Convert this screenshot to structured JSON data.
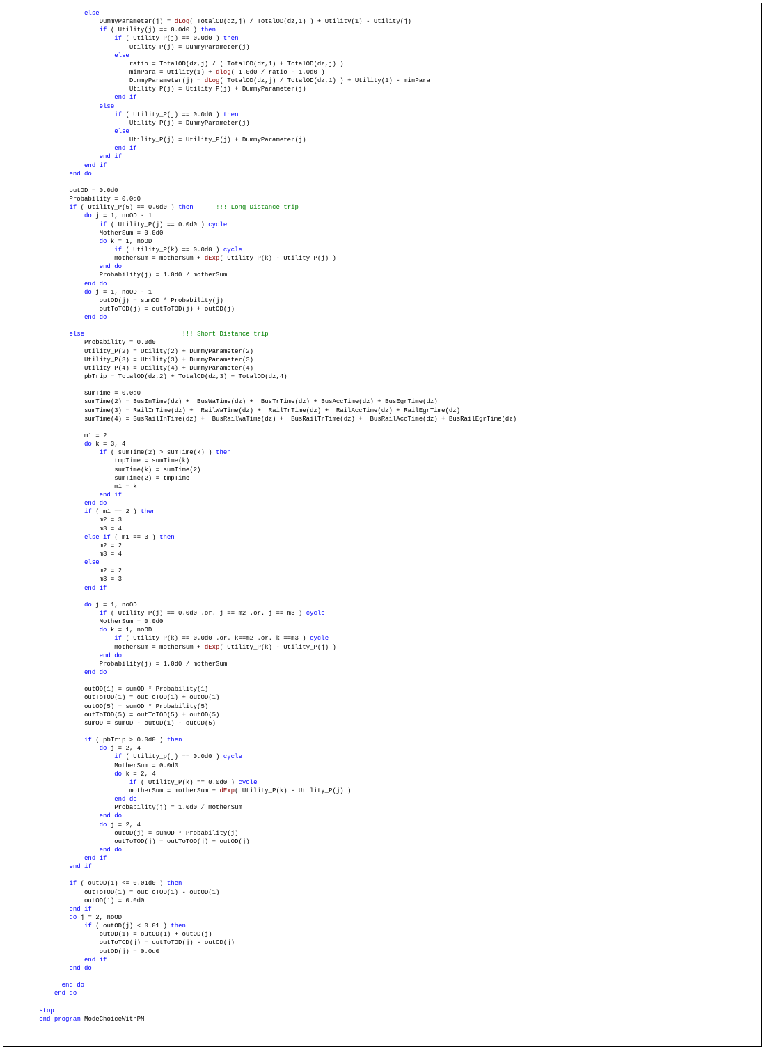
{
  "code": [
    {
      "indent": 12,
      "tokens": [
        {
          "t": "else",
          "c": "kw"
        }
      ]
    },
    {
      "indent": 16,
      "tokens": [
        {
          "t": "DummyParameter(j) = "
        },
        {
          "t": "dLog",
          "c": "fn"
        },
        {
          "t": "( TotalOD(dz,j) / TotalOD(dz,1) ) + Utility(1) - Utility(j)"
        }
      ]
    },
    {
      "indent": 16,
      "tokens": [
        {
          "t": "if",
          "c": "kw"
        },
        {
          "t": " ( Utility(j) == 0.0d0 ) "
        },
        {
          "t": "then",
          "c": "kw"
        }
      ]
    },
    {
      "indent": 20,
      "tokens": [
        {
          "t": "if",
          "c": "kw"
        },
        {
          "t": " ( Utility_P(j) == 0.0d0 ) "
        },
        {
          "t": "then",
          "c": "kw"
        }
      ]
    },
    {
      "indent": 24,
      "tokens": [
        {
          "t": "Utility_P(j) = DummyParameter(j)"
        }
      ]
    },
    {
      "indent": 20,
      "tokens": [
        {
          "t": "else",
          "c": "kw"
        }
      ]
    },
    {
      "indent": 24,
      "tokens": [
        {
          "t": "ratio = TotalOD(dz,j) / ( TotalOD(dz,1) + TotalOD(dz,j) )"
        }
      ]
    },
    {
      "indent": 24,
      "tokens": [
        {
          "t": "minPara = Utility(1) + "
        },
        {
          "t": "dlog",
          "c": "fn"
        },
        {
          "t": "( 1.0d0 / ratio - 1.0d0 )"
        }
      ]
    },
    {
      "indent": 24,
      "tokens": [
        {
          "t": "DummyParameter(j) = "
        },
        {
          "t": "dLog",
          "c": "fn"
        },
        {
          "t": "( TotalOD(dz,j) / TotalOD(dz,1) ) + Utility(1) - minPara"
        }
      ]
    },
    {
      "indent": 24,
      "tokens": [
        {
          "t": "Utility_P(j) = Utility_P(j) + DummyParameter(j)"
        }
      ]
    },
    {
      "indent": 20,
      "tokens": [
        {
          "t": "end if",
          "c": "kw"
        }
      ]
    },
    {
      "indent": 16,
      "tokens": [
        {
          "t": "else",
          "c": "kw"
        }
      ]
    },
    {
      "indent": 20,
      "tokens": [
        {
          "t": "if",
          "c": "kw"
        },
        {
          "t": " ( Utility_P(j) == 0.0d0 ) "
        },
        {
          "t": "then",
          "c": "kw"
        }
      ]
    },
    {
      "indent": 24,
      "tokens": [
        {
          "t": "Utility_P(j) = DummyParameter(j)"
        }
      ]
    },
    {
      "indent": 20,
      "tokens": [
        {
          "t": "else",
          "c": "kw"
        }
      ]
    },
    {
      "indent": 24,
      "tokens": [
        {
          "t": "Utility_P(j) = Utility_P(j) + DummyParameter(j)"
        }
      ]
    },
    {
      "indent": 20,
      "tokens": [
        {
          "t": "end if",
          "c": "kw"
        }
      ]
    },
    {
      "indent": 16,
      "tokens": [
        {
          "t": "end if",
          "c": "kw"
        }
      ]
    },
    {
      "indent": 12,
      "tokens": [
        {
          "t": "end if",
          "c": "kw"
        }
      ]
    },
    {
      "indent": 8,
      "tokens": [
        {
          "t": "end do",
          "c": "kw"
        }
      ]
    },
    {
      "indent": 0,
      "tokens": [
        {
          "t": ""
        }
      ]
    },
    {
      "indent": 8,
      "tokens": [
        {
          "t": "outOD = 0.0d0"
        }
      ]
    },
    {
      "indent": 8,
      "tokens": [
        {
          "t": "Probability = 0.0d0"
        }
      ]
    },
    {
      "indent": 8,
      "tokens": [
        {
          "t": "if",
          "c": "kw"
        },
        {
          "t": " ( Utility_P(5) == 0.0d0 ) "
        },
        {
          "t": "then",
          "c": "kw"
        },
        {
          "t": "      "
        },
        {
          "t": "!!! Long Distance trip",
          "c": "cm"
        }
      ]
    },
    {
      "indent": 12,
      "tokens": [
        {
          "t": "do",
          "c": "kw"
        },
        {
          "t": " j = 1, noOD - 1"
        }
      ]
    },
    {
      "indent": 16,
      "tokens": [
        {
          "t": "if",
          "c": "kw"
        },
        {
          "t": " ( Utility_P(j) == 0.0d0 ) "
        },
        {
          "t": "cycle",
          "c": "kw"
        }
      ]
    },
    {
      "indent": 16,
      "tokens": [
        {
          "t": "MotherSum = 0.0d0"
        }
      ]
    },
    {
      "indent": 16,
      "tokens": [
        {
          "t": "do",
          "c": "kw"
        },
        {
          "t": " k = 1, noOD"
        }
      ]
    },
    {
      "indent": 20,
      "tokens": [
        {
          "t": "if",
          "c": "kw"
        },
        {
          "t": " ( Utility_P(k) == 0.0d0 ) "
        },
        {
          "t": "cycle",
          "c": "kw"
        }
      ]
    },
    {
      "indent": 20,
      "tokens": [
        {
          "t": "motherSum = motherSum + "
        },
        {
          "t": "dExp",
          "c": "fn"
        },
        {
          "t": "( Utility_P(k) - Utility_P(j) )"
        }
      ]
    },
    {
      "indent": 16,
      "tokens": [
        {
          "t": "end do",
          "c": "kw"
        }
      ]
    },
    {
      "indent": 16,
      "tokens": [
        {
          "t": "Probability(j) = 1.0d0 / motherSum"
        }
      ]
    },
    {
      "indent": 12,
      "tokens": [
        {
          "t": "end do",
          "c": "kw"
        }
      ]
    },
    {
      "indent": 12,
      "tokens": [
        {
          "t": "do",
          "c": "kw"
        },
        {
          "t": " j = 1, noOD - 1"
        }
      ]
    },
    {
      "indent": 16,
      "tokens": [
        {
          "t": "outOD(j) = sumOD * Probability(j)"
        }
      ]
    },
    {
      "indent": 16,
      "tokens": [
        {
          "t": "outToTOD(j) = outToTOD(j) + outOD(j)"
        }
      ]
    },
    {
      "indent": 12,
      "tokens": [
        {
          "t": "end do",
          "c": "kw"
        }
      ]
    },
    {
      "indent": 0,
      "tokens": [
        {
          "t": ""
        }
      ]
    },
    {
      "indent": 8,
      "tokens": [
        {
          "t": "else",
          "c": "kw"
        },
        {
          "t": "                          "
        },
        {
          "t": "!!! Short Distance trip",
          "c": "cm"
        }
      ]
    },
    {
      "indent": 12,
      "tokens": [
        {
          "t": "Probability = 0.0d0"
        }
      ]
    },
    {
      "indent": 12,
      "tokens": [
        {
          "t": "Utility_P(2) = Utility(2) + DummyParameter(2)"
        }
      ]
    },
    {
      "indent": 12,
      "tokens": [
        {
          "t": "Utility_P(3) = Utility(3) + DummyParameter(3)"
        }
      ]
    },
    {
      "indent": 12,
      "tokens": [
        {
          "t": "Utility_P(4) = Utility(4) + DummyParameter(4)"
        }
      ]
    },
    {
      "indent": 12,
      "tokens": [
        {
          "t": "pbTrip = TotalOD(dz,2) + TotalOD(dz,3) + TotalOD(dz,4)"
        }
      ]
    },
    {
      "indent": 0,
      "tokens": [
        {
          "t": ""
        }
      ]
    },
    {
      "indent": 12,
      "tokens": [
        {
          "t": "SumTime = 0.0d0"
        }
      ]
    },
    {
      "indent": 12,
      "tokens": [
        {
          "t": "sumTime(2) = BusInTime(dz) +  BusWaTime(dz) +  BusTrTime(dz) + BusAccTime(dz) + BusEgrTime(dz)"
        }
      ]
    },
    {
      "indent": 12,
      "tokens": [
        {
          "t": "sumTime(3) = RailInTime(dz) +  RailWaTime(dz) +  RailTrTime(dz) +  RailAccTime(dz) + RailEgrTime(dz)"
        }
      ]
    },
    {
      "indent": 12,
      "tokens": [
        {
          "t": "sumTime(4) = BusRailInTime(dz) +  BusRailWaTime(dz) +  BusRailTrTime(dz) +  BusRailAccTime(dz) + BusRailEgrTime(dz)"
        }
      ]
    },
    {
      "indent": 0,
      "tokens": [
        {
          "t": ""
        }
      ]
    },
    {
      "indent": 12,
      "tokens": [
        {
          "t": "m1 = 2"
        }
      ]
    },
    {
      "indent": 12,
      "tokens": [
        {
          "t": "do",
          "c": "kw"
        },
        {
          "t": " k = 3, 4"
        }
      ]
    },
    {
      "indent": 16,
      "tokens": [
        {
          "t": "if",
          "c": "kw"
        },
        {
          "t": " ( sumTime(2) > sumTime(k) ) "
        },
        {
          "t": "then",
          "c": "kw"
        }
      ]
    },
    {
      "indent": 20,
      "tokens": [
        {
          "t": "tmpTime = sumTime(k)"
        }
      ]
    },
    {
      "indent": 20,
      "tokens": [
        {
          "t": "sumTime(k) = sumTime(2)"
        }
      ]
    },
    {
      "indent": 20,
      "tokens": [
        {
          "t": "sumTime(2) = tmpTime"
        }
      ]
    },
    {
      "indent": 20,
      "tokens": [
        {
          "t": "m1 = k"
        }
      ]
    },
    {
      "indent": 16,
      "tokens": [
        {
          "t": "end if",
          "c": "kw"
        }
      ]
    },
    {
      "indent": 12,
      "tokens": [
        {
          "t": "end do",
          "c": "kw"
        }
      ]
    },
    {
      "indent": 12,
      "tokens": [
        {
          "t": "if",
          "c": "kw"
        },
        {
          "t": " ( m1 == 2 ) "
        },
        {
          "t": "then",
          "c": "kw"
        }
      ]
    },
    {
      "indent": 16,
      "tokens": [
        {
          "t": "m2 = 3"
        }
      ]
    },
    {
      "indent": 16,
      "tokens": [
        {
          "t": "m3 = 4"
        }
      ]
    },
    {
      "indent": 12,
      "tokens": [
        {
          "t": "else if",
          "c": "kw"
        },
        {
          "t": " ( m1 == 3 ) "
        },
        {
          "t": "then",
          "c": "kw"
        }
      ]
    },
    {
      "indent": 16,
      "tokens": [
        {
          "t": "m2 = 2"
        }
      ]
    },
    {
      "indent": 16,
      "tokens": [
        {
          "t": "m3 = 4"
        }
      ]
    },
    {
      "indent": 12,
      "tokens": [
        {
          "t": "else",
          "c": "kw"
        }
      ]
    },
    {
      "indent": 16,
      "tokens": [
        {
          "t": "m2 = 2"
        }
      ]
    },
    {
      "indent": 16,
      "tokens": [
        {
          "t": "m3 = 3"
        }
      ]
    },
    {
      "indent": 12,
      "tokens": [
        {
          "t": "end if",
          "c": "kw"
        }
      ]
    },
    {
      "indent": 0,
      "tokens": [
        {
          "t": ""
        }
      ]
    },
    {
      "indent": 12,
      "tokens": [
        {
          "t": "do",
          "c": "kw"
        },
        {
          "t": " j = 1, noOD"
        }
      ]
    },
    {
      "indent": 16,
      "tokens": [
        {
          "t": "if",
          "c": "kw"
        },
        {
          "t": " ( Utility_P(j) == 0.0d0 .or. j == m2 .or. j == m3 ) "
        },
        {
          "t": "cycle",
          "c": "kw"
        }
      ]
    },
    {
      "indent": 16,
      "tokens": [
        {
          "t": "MotherSum = 0.0d0"
        }
      ]
    },
    {
      "indent": 16,
      "tokens": [
        {
          "t": "do",
          "c": "kw"
        },
        {
          "t": " k = 1, noOD"
        }
      ]
    },
    {
      "indent": 20,
      "tokens": [
        {
          "t": "if",
          "c": "kw"
        },
        {
          "t": " ( Utility_P(k) == 0.0d0 .or. k==m2 .or. k ==m3 ) "
        },
        {
          "t": "cycle",
          "c": "kw"
        }
      ]
    },
    {
      "indent": 20,
      "tokens": [
        {
          "t": "motherSum = motherSum + "
        },
        {
          "t": "dExp",
          "c": "fn"
        },
        {
          "t": "( Utility_P(k) - Utility_P(j) )"
        }
      ]
    },
    {
      "indent": 16,
      "tokens": [
        {
          "t": "end do",
          "c": "kw"
        }
      ]
    },
    {
      "indent": 16,
      "tokens": [
        {
          "t": "Probability(j) = 1.0d0 / motherSum"
        }
      ]
    },
    {
      "indent": 12,
      "tokens": [
        {
          "t": "end do",
          "c": "kw"
        }
      ]
    },
    {
      "indent": 0,
      "tokens": [
        {
          "t": ""
        }
      ]
    },
    {
      "indent": 12,
      "tokens": [
        {
          "t": "outOD(1) = sumOD * Probability(1)"
        }
      ]
    },
    {
      "indent": 12,
      "tokens": [
        {
          "t": "outToTOD(1) = outToTOD(1) + outOD(1)"
        }
      ]
    },
    {
      "indent": 12,
      "tokens": [
        {
          "t": "outOD(5) = sumOD * Probability(5)"
        }
      ]
    },
    {
      "indent": 12,
      "tokens": [
        {
          "t": "outToTOD(5) = outToTOD(5) + outOD(5)"
        }
      ]
    },
    {
      "indent": 12,
      "tokens": [
        {
          "t": "sumOD = sumOD - outOD(1) - outOD(5)"
        }
      ]
    },
    {
      "indent": 0,
      "tokens": [
        {
          "t": ""
        }
      ]
    },
    {
      "indent": 12,
      "tokens": [
        {
          "t": "if",
          "c": "kw"
        },
        {
          "t": " ( pbTrip > 0.0d0 ) "
        },
        {
          "t": "then",
          "c": "kw"
        }
      ]
    },
    {
      "indent": 16,
      "tokens": [
        {
          "t": "do",
          "c": "kw"
        },
        {
          "t": " j = 2, 4"
        }
      ]
    },
    {
      "indent": 20,
      "tokens": [
        {
          "t": "if",
          "c": "kw"
        },
        {
          "t": " ( Utility_p(j) == 0.0d0 ) "
        },
        {
          "t": "cycle",
          "c": "kw"
        }
      ]
    },
    {
      "indent": 20,
      "tokens": [
        {
          "t": "MotherSum = 0.0d0"
        }
      ]
    },
    {
      "indent": 20,
      "tokens": [
        {
          "t": "do",
          "c": "kw"
        },
        {
          "t": " k = 2, 4"
        }
      ]
    },
    {
      "indent": 24,
      "tokens": [
        {
          "t": "if",
          "c": "kw"
        },
        {
          "t": " ( Utility_P(k) == 0.0d0 ) "
        },
        {
          "t": "cycle",
          "c": "kw"
        }
      ]
    },
    {
      "indent": 24,
      "tokens": [
        {
          "t": "motherSum = motherSum + "
        },
        {
          "t": "dExp",
          "c": "fn"
        },
        {
          "t": "( Utility_P(k) - Utility_P(j) )"
        }
      ]
    },
    {
      "indent": 20,
      "tokens": [
        {
          "t": "end do",
          "c": "kw"
        }
      ]
    },
    {
      "indent": 20,
      "tokens": [
        {
          "t": "Probability(j) = 1.0d0 / motherSum"
        }
      ]
    },
    {
      "indent": 16,
      "tokens": [
        {
          "t": "end do",
          "c": "kw"
        }
      ]
    },
    {
      "indent": 16,
      "tokens": [
        {
          "t": "do",
          "c": "kw"
        },
        {
          "t": " j = 2, 4"
        }
      ]
    },
    {
      "indent": 20,
      "tokens": [
        {
          "t": "outOD(j) = sumOD * Probability(j)"
        }
      ]
    },
    {
      "indent": 20,
      "tokens": [
        {
          "t": "outToTOD(j) = outToTOD(j) + outOD(j)"
        }
      ]
    },
    {
      "indent": 16,
      "tokens": [
        {
          "t": "end do",
          "c": "kw"
        }
      ]
    },
    {
      "indent": 12,
      "tokens": [
        {
          "t": "end if",
          "c": "kw"
        }
      ]
    },
    {
      "indent": 8,
      "tokens": [
        {
          "t": "end if",
          "c": "kw"
        }
      ]
    },
    {
      "indent": 0,
      "tokens": [
        {
          "t": ""
        }
      ]
    },
    {
      "indent": 8,
      "tokens": [
        {
          "t": "if",
          "c": "kw"
        },
        {
          "t": " ( outOD(1) <= 0.01d0 ) "
        },
        {
          "t": "then",
          "c": "kw"
        }
      ]
    },
    {
      "indent": 12,
      "tokens": [
        {
          "t": "outToTOD(1) = outToTOD(1) - outOD(1)"
        }
      ]
    },
    {
      "indent": 12,
      "tokens": [
        {
          "t": "outOD(1) = 0.0d0"
        }
      ]
    },
    {
      "indent": 8,
      "tokens": [
        {
          "t": "end if",
          "c": "kw"
        }
      ]
    },
    {
      "indent": 8,
      "tokens": [
        {
          "t": "do",
          "c": "kw"
        },
        {
          "t": " j = 2, noOD"
        }
      ]
    },
    {
      "indent": 12,
      "tokens": [
        {
          "t": "if",
          "c": "kw"
        },
        {
          "t": " ( outOD(j) < 0.01 ) "
        },
        {
          "t": "then",
          "c": "kw"
        }
      ]
    },
    {
      "indent": 16,
      "tokens": [
        {
          "t": "outOD(1) = outOD(1) + outOD(j)"
        }
      ]
    },
    {
      "indent": 16,
      "tokens": [
        {
          "t": "outToTOD(j) = outToTOD(j) - outOD(j)"
        }
      ]
    },
    {
      "indent": 16,
      "tokens": [
        {
          "t": "outOD(j) = 0.0d0"
        }
      ]
    },
    {
      "indent": 12,
      "tokens": [
        {
          "t": "end if",
          "c": "kw"
        }
      ]
    },
    {
      "indent": 8,
      "tokens": [
        {
          "t": "end do",
          "c": "kw"
        }
      ]
    },
    {
      "indent": 0,
      "tokens": [
        {
          "t": ""
        }
      ]
    },
    {
      "indent": 6,
      "tokens": [
        {
          "t": "end do",
          "c": "kw"
        }
      ]
    },
    {
      "indent": 4,
      "tokens": [
        {
          "t": "end do",
          "c": "kw"
        }
      ]
    },
    {
      "indent": 0,
      "tokens": [
        {
          "t": ""
        }
      ]
    },
    {
      "indent": 0,
      "tokens": [
        {
          "t": "stop",
          "c": "kw"
        }
      ]
    },
    {
      "indent": 0,
      "tokens": [
        {
          "t": "end program",
          "c": "kw"
        },
        {
          "t": " ModeChoiceWithPM"
        }
      ]
    }
  ],
  "base_indent": 8
}
